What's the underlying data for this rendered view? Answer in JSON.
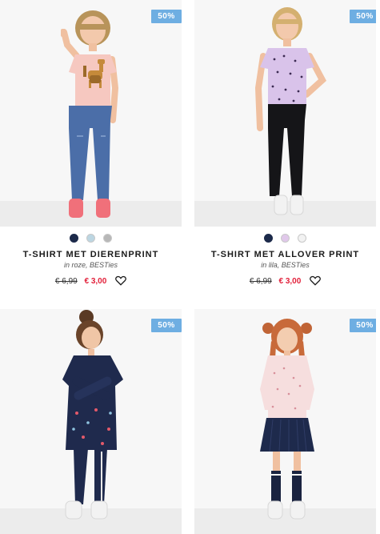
{
  "products": [
    {
      "badge": "50%",
      "title": "T-SHIRT MET DIERENPRINT",
      "subtitle": "in roze, BESTies",
      "old_price": "€ 6,99",
      "new_price": "€ 3,00",
      "swatches": [
        "#1c2a4a",
        "#bcd6e2",
        "#b7b7b7"
      ]
    },
    {
      "badge": "50%",
      "title": "T-SHIRT MET ALLOVER PRINT",
      "subtitle": "in lila, BESTies",
      "old_price": "€ 6,99",
      "new_price": "€ 3,00",
      "swatches": [
        "#1c2a4a",
        "#e0c8ea",
        "#f2f2f2"
      ]
    },
    {
      "badge": "50%"
    },
    {
      "badge": "50%"
    }
  ],
  "colors": {
    "badge": "#6eaee2",
    "sale_price": "#e2203a"
  }
}
